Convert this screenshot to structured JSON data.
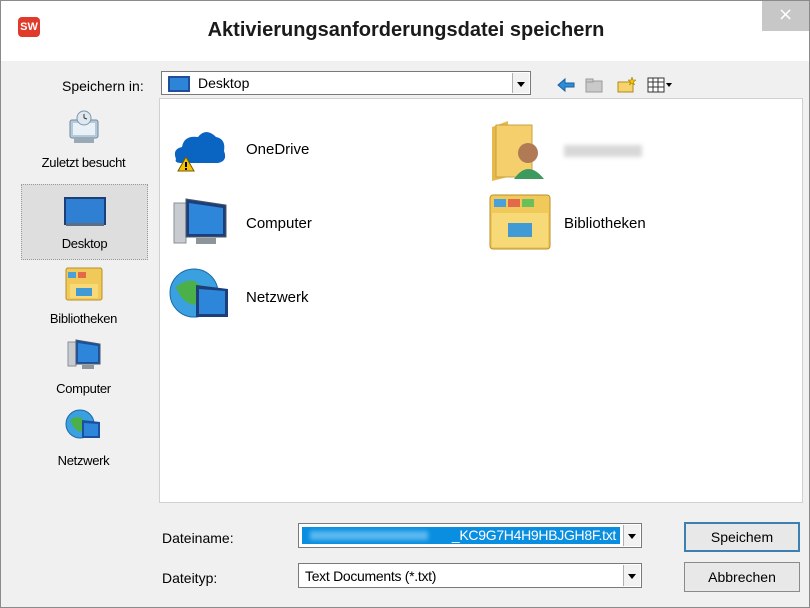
{
  "window": {
    "title": "Aktivierungsanforderungsdatei speichern",
    "app_icon_text": "SW",
    "close_glyph": "×"
  },
  "location": {
    "label": "Speichern in:",
    "value": "Desktop"
  },
  "places": [
    {
      "label": "Zuletzt besucht",
      "icon": "recent-places-icon"
    },
    {
      "label": "Desktop",
      "icon": "desktop-icon",
      "selected": true
    },
    {
      "label": "Bibliotheken",
      "icon": "libraries-icon"
    },
    {
      "label": "Computer",
      "icon": "computer-icon"
    },
    {
      "label": "Netzwerk",
      "icon": "network-icon"
    }
  ],
  "items": [
    {
      "label": "OneDrive",
      "icon": "onedrive-icon"
    },
    {
      "label": "Computer",
      "icon": "computer-icon"
    },
    {
      "label": "Netzwerk",
      "icon": "network-icon"
    },
    {
      "label": "",
      "icon": "user-folder-icon"
    },
    {
      "label": "Bibliotheken",
      "icon": "libraries-folder-icon"
    }
  ],
  "filename": {
    "label": "Dateiname:",
    "value_visible": "_KC9G7H4H9HBJGH8F.txt"
  },
  "filetype": {
    "label": "Dateityp:",
    "value": "Text Documents (*.txt)"
  },
  "buttons": {
    "save": "Speichem",
    "cancel": "Abbrechen"
  },
  "colors": {
    "accent": "#0078d7",
    "selection": "#3399ff"
  }
}
